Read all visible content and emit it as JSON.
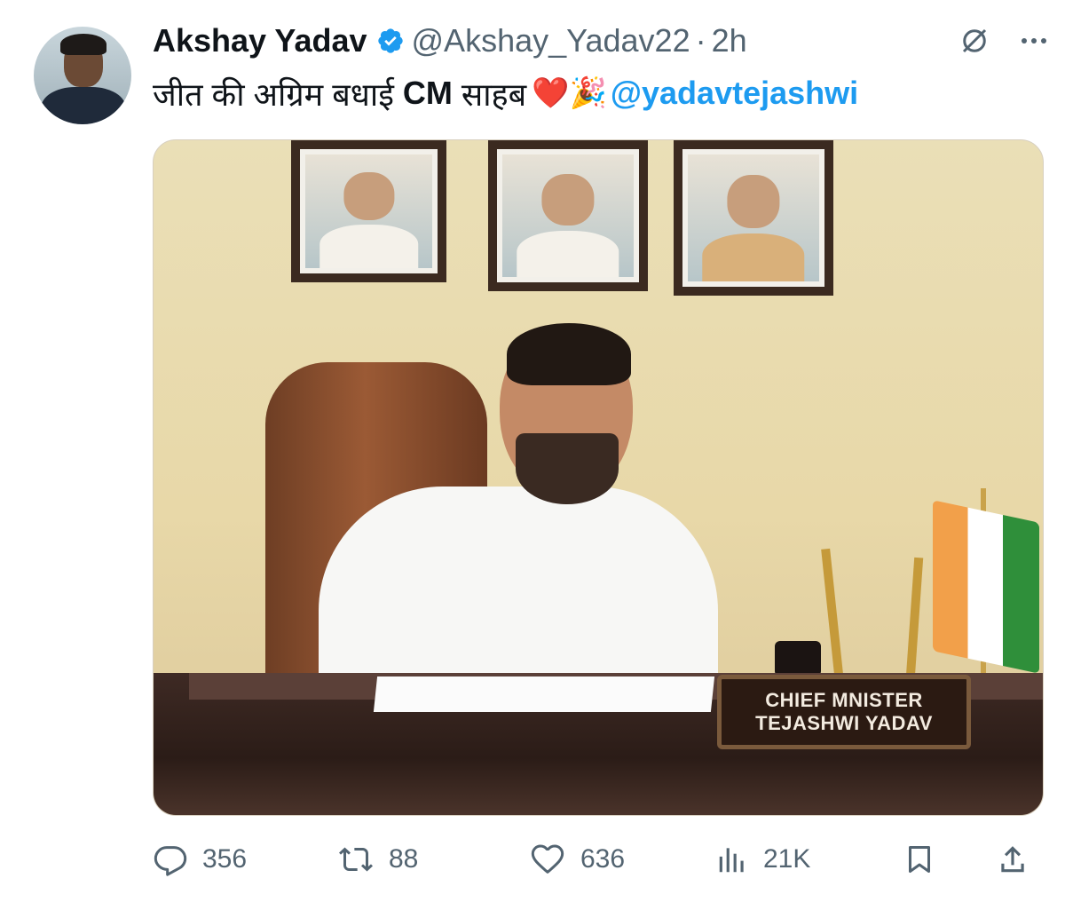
{
  "tweet": {
    "author_name": "Akshay Yadav",
    "handle": "@Akshay_Yadav22",
    "separator": "·",
    "time": "2h",
    "text_hindi": "जीत की अग्रिम बधाई",
    "text_cm": "CM",
    "text_saheb": "साहब",
    "emoji": "❤️🎉",
    "mention": "@yadavtejashwi"
  },
  "media": {
    "nameplate_line1": "CHIEF MNISTER",
    "nameplate_line2": "TEJASHWI YADAV"
  },
  "actions": {
    "replies": "356",
    "retweets": "88",
    "likes": "636",
    "views": "21K"
  },
  "colors": {
    "accent": "#1d9bf0",
    "muted": "#536471",
    "text": "#0f1419"
  },
  "icons": [
    "verified-badge-icon",
    "grok-icon",
    "more-icon",
    "reply-icon",
    "retweet-icon",
    "like-icon",
    "views-icon",
    "bookmark-icon",
    "share-icon"
  ]
}
